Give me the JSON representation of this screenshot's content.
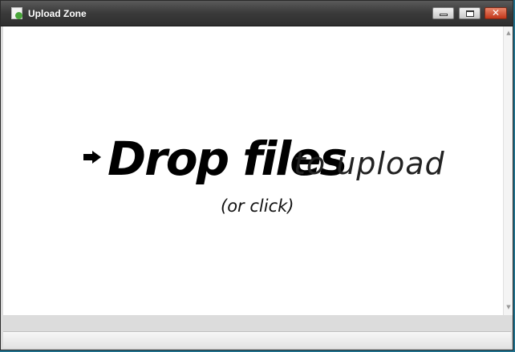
{
  "window": {
    "title": "Upload Zone",
    "icon": "app-icon",
    "controls": {
      "minimize": "minimize-icon",
      "maximize": "maximize-icon",
      "close_label": "✕"
    }
  },
  "dropzone": {
    "strong_text": "Drop files",
    "light_text": "to upload",
    "sub_text": "(or click)",
    "arrow_icon": "arrow-right-icon"
  },
  "scrollbar": {
    "up": "▲",
    "down": "▼"
  }
}
